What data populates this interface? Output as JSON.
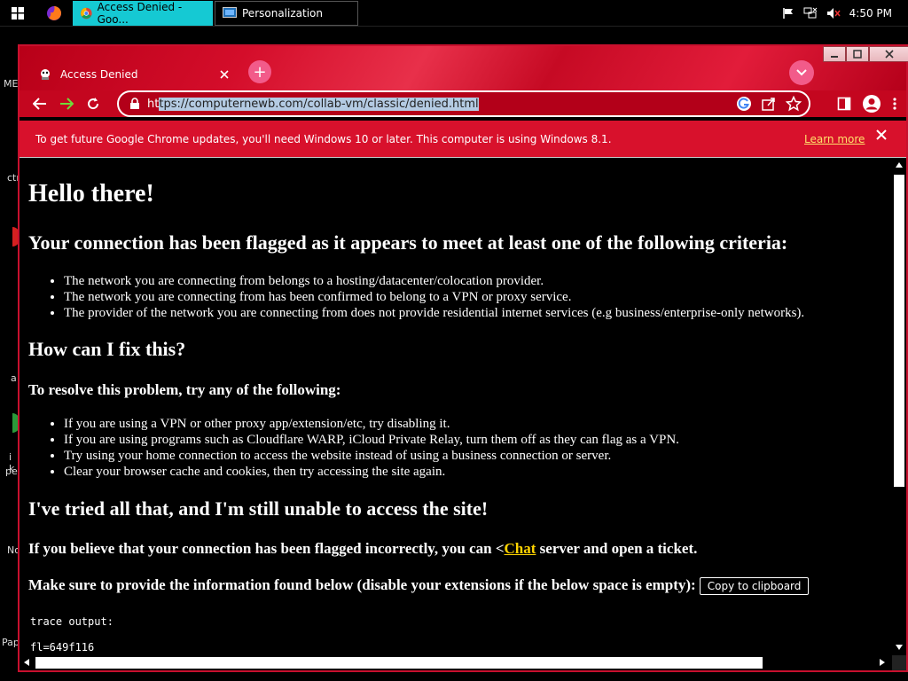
{
  "taskbar": {
    "tasks": [
      {
        "label": "Access Denied - Goo..."
      },
      {
        "label": "Personalization"
      }
    ],
    "clock": "4:50 PM"
  },
  "desktop": {
    "labels": [
      "ME",
      "ctr",
      "a",
      "i k",
      "pe",
      "No",
      "Pap"
    ]
  },
  "browser": {
    "tab_title": "Access Denied",
    "new_tab_label": "+",
    "url_prefix": "ht",
    "url_selected": "tps://computernewb.com/collab-vm/classic/denied.html",
    "infobar_text": "To get future Google Chrome updates, you'll need Windows 10 or later. This computer is using Windows 8.1.",
    "infobar_link": "Learn more"
  },
  "page": {
    "h1": "Hello there!",
    "h2_flagged": "Your connection has been flagged as it appears to meet at least one of the following criteria:",
    "criteria": [
      "The network you are connecting from belongs to a hosting/datacenter/colocation provider.",
      "The network you are connecting from has been confirmed to belong to a VPN or proxy service.",
      "The provider of the network you are connecting from does not provide residential internet services (e.g business/enterprise-only networks)."
    ],
    "h2_fix": "How can I fix this?",
    "h3_resolve": "To resolve this problem, try any of the following:",
    "fixes": [
      "If you are using a VPN or other proxy app/extension/etc, try disabling it.",
      "If you are using programs such as Cloudflare WARP, iCloud Private Relay, turn them off as they can flag as a VPN.",
      "Try using your home connection to access the website instead of using a business connection or server.",
      "Clear your browser cache and cookies, then try accessing the site again."
    ],
    "h2_tried": "I've tried all that, and I'm still unable to access the site!",
    "ticket_before": "If you believe that your connection has been flagged incorrectly, you can <",
    "ticket_link": "Chat",
    "ticket_after": " server and open a ticket.",
    "info_text": "Make sure to provide the information found below (disable your extensions if the below space is empty):",
    "copy_button": "Copy to clipboard",
    "trace_label": "trace output:",
    "trace_first": "fl=649f116"
  },
  "colors": {
    "accent_red": "#d8112c",
    "link_yellow": "#ffd400",
    "taskbar_active": "#15c9d3"
  }
}
